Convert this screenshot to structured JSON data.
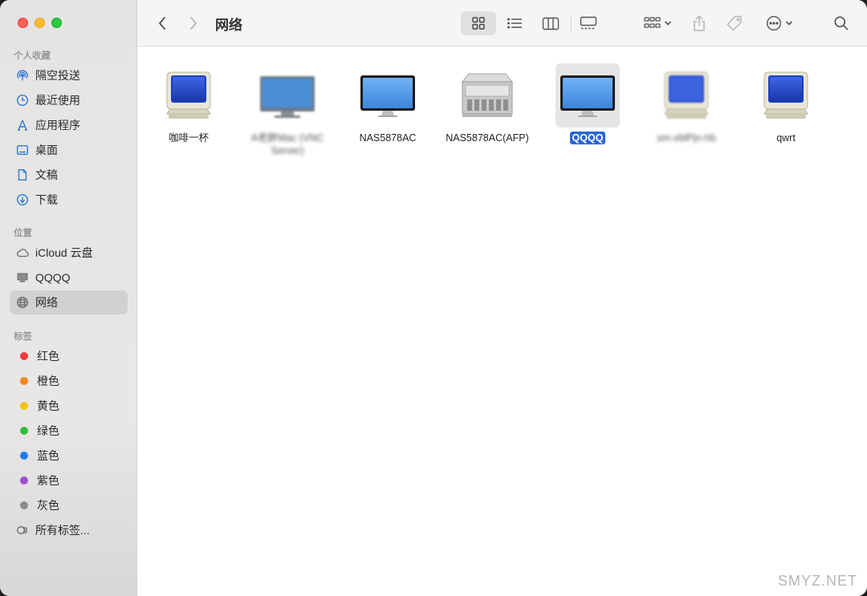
{
  "window": {
    "title": "网络"
  },
  "sidebar": {
    "favorites_header": "个人收藏",
    "favorites": [
      {
        "label": "隔空投送",
        "icon": "airdrop-icon"
      },
      {
        "label": "最近使用",
        "icon": "clock-icon"
      },
      {
        "label": "应用程序",
        "icon": "applications-icon"
      },
      {
        "label": "桌面",
        "icon": "desktop-icon"
      },
      {
        "label": "文稿",
        "icon": "document-icon"
      },
      {
        "label": "下载",
        "icon": "download-icon"
      }
    ],
    "locations_header": "位置",
    "locations": [
      {
        "label": "iCloud 云盘",
        "icon": "cloud-icon"
      },
      {
        "label": "QQQQ",
        "icon": "computer-icon"
      },
      {
        "label": "网络",
        "icon": "network-globe-icon",
        "active": true
      }
    ],
    "tags_header": "标签",
    "tags": [
      {
        "label": "红色",
        "color": "#ee3b3b"
      },
      {
        "label": "橙色",
        "color": "#f08a1c"
      },
      {
        "label": "黄色",
        "color": "#f5c21b"
      },
      {
        "label": "绿色",
        "color": "#2fbf3a"
      },
      {
        "label": "蓝色",
        "color": "#1f7cf2"
      },
      {
        "label": "紫色",
        "color": "#a34ad2"
      },
      {
        "label": "灰色",
        "color": "#8a8a8e"
      }
    ],
    "all_tags": "所有标签..."
  },
  "toolbar": {
    "title": "网络",
    "view_icons": [
      "grid-view-icon",
      "list-view-icon",
      "column-view-icon",
      "gallery-view-icon"
    ],
    "active_view": "grid-view-icon"
  },
  "items": [
    {
      "label": "咖啡一杯",
      "type": "crt"
    },
    {
      "label": "A老胖Mac (VNC Server)",
      "type": "flat-blurred",
      "blurred": true
    },
    {
      "label": "NAS5878AC",
      "type": "imac"
    },
    {
      "label": "NAS5878AC(AFP)",
      "type": "server"
    },
    {
      "label": "QQQQ",
      "type": "imac",
      "selected": true
    },
    {
      "label": "sm-xMPjn-hb",
      "type": "crt-blurred",
      "blurred": true
    },
    {
      "label": "qwrt",
      "type": "crt"
    }
  ],
  "watermark": "SMYZ.NET"
}
